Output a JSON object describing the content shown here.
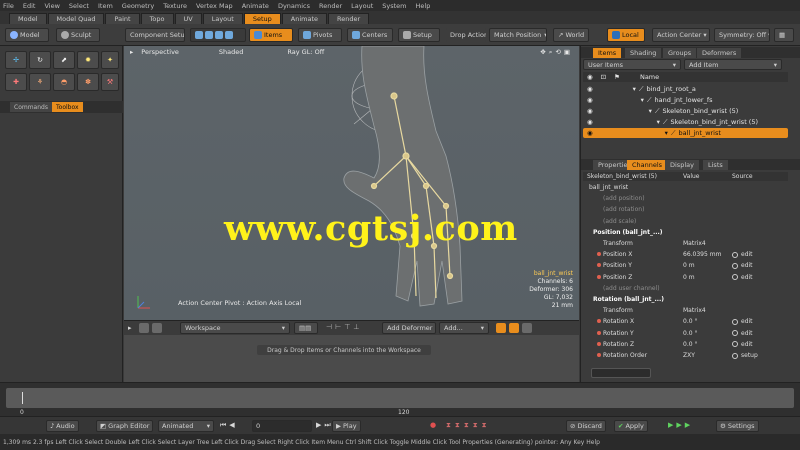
{
  "menu": [
    "File",
    "Edit",
    "View",
    "Select",
    "Item",
    "Geometry",
    "Texture",
    "Vertex Map",
    "Animate",
    "Dynamics",
    "Render",
    "Layout",
    "System",
    "Help"
  ],
  "layout_tabs": [
    "Model",
    "Model Quad",
    "Paint",
    "Topo",
    "UV",
    "Layout",
    "Setup",
    "Animate",
    "Render"
  ],
  "layout_active": "Setup",
  "toolbar": {
    "model_label": "Model",
    "sculpt_label": "Sculpt",
    "component_setup": "Component Setup",
    "items_label": "Items",
    "pivots_label": "Pivots",
    "centers_label": "Centers",
    "setup_label": "Setup",
    "drop_action": "Drop Action",
    "match_position": "Match Position",
    "world_label": "World",
    "local_label": "Local",
    "action_center": "Action Center",
    "symmetry": "Symmetry: Off"
  },
  "left_panel": {
    "tabs": [
      "Commands",
      "Toolbox"
    ],
    "active_tab": "Toolbox"
  },
  "viewport": {
    "view_label": "Perspective",
    "shading_label": "Shaded",
    "ray_gl": "Ray GL: Off",
    "watermark": "www.cgtsj.com",
    "info_lines": [
      "ball_jnt_wrist",
      "Channels: 6",
      "Deformer: 306",
      "GL: 7,032",
      "21 mm"
    ],
    "action_center_text": "Action Center Pivot : Action Axis Local"
  },
  "workspace": {
    "dropdown": "Workspace",
    "add_deformer": "Add Deformer",
    "add_label": "Add...",
    "hint": "Drag & Drop Items or Channels into the Workspace"
  },
  "items_panel": {
    "tabs": [
      "Items",
      "Shading",
      "Groups",
      "Deformers"
    ],
    "active_tab": "Items",
    "filter_label": "User Items",
    "add_item": "Add Item",
    "column_name": "Name",
    "rows": [
      {
        "label": "bind_jnt_root_a",
        "indent": 0
      },
      {
        "label": "hand_jnt_lower_fs",
        "indent": 1
      },
      {
        "label": "Skeleton_bind_wrist (5)",
        "indent": 2
      },
      {
        "label": "Skeleton_bind_jnt_wrist (5)",
        "indent": 3
      },
      {
        "label": "ball_jnt_wrist",
        "indent": 4
      }
    ]
  },
  "channels_panel": {
    "tabs": [
      "Properties",
      "Channels",
      "Display",
      "Lists"
    ],
    "active_tab": "Channels",
    "headers": [
      "Skeleton_bind_wrist (5)",
      "Value",
      "Source"
    ],
    "rows": [
      {
        "label": "ball_jnt_wrist",
        "value": "",
        "source": "",
        "kind": "group"
      },
      {
        "label": "(add position)",
        "value": "",
        "source": "",
        "kind": "muted"
      },
      {
        "label": "(add rotation)",
        "value": "",
        "source": "",
        "kind": "muted"
      },
      {
        "label": "(add scale)",
        "value": "",
        "source": "",
        "kind": "muted"
      },
      {
        "label": "Position (ball_jnt_...)",
        "value": "",
        "source": "",
        "kind": "section"
      },
      {
        "label": "Transform",
        "value": "Matrix4",
        "source": "",
        "kind": "plain"
      },
      {
        "label": "Position X",
        "value": "66.0395 mm",
        "source": "edit",
        "kind": "channel"
      },
      {
        "label": "Position Y",
        "value": "0 m",
        "source": "edit",
        "kind": "channel"
      },
      {
        "label": "Position Z",
        "value": "0 m",
        "source": "edit",
        "kind": "channel"
      },
      {
        "label": "(add user channel)",
        "value": "",
        "source": "",
        "kind": "muted"
      },
      {
        "label": "Rotation (ball_jnt_...)",
        "value": "",
        "source": "",
        "kind": "section"
      },
      {
        "label": "Transform",
        "value": "Matrix4",
        "source": "",
        "kind": "plain"
      },
      {
        "label": "Rotation X",
        "value": "0.0 °",
        "source": "edit",
        "kind": "channel"
      },
      {
        "label": "Rotation Y",
        "value": "0.0 °",
        "source": "edit",
        "kind": "channel"
      },
      {
        "label": "Rotation Z",
        "value": "0.0 °",
        "source": "edit",
        "kind": "channel"
      },
      {
        "label": "Rotation Order",
        "value": "ZXY",
        "source": "setup",
        "kind": "channel"
      }
    ],
    "search_placeholder": ""
  },
  "timeline": {
    "ticks": [
      "0",
      "120"
    ]
  },
  "transport": {
    "audio": "Audio",
    "graph_editor": "Graph Editor",
    "animated": "Animated",
    "frame": "0",
    "play": "Play",
    "discard": "Discard",
    "apply": "Apply",
    "settings": "Settings"
  },
  "status": "1,309 ms  2.3 fps   Left Click Select  Double Left Click Select Layer Tree  Left Click Drag Select  Right Click Item Menu  Ctrl Shift Click Toggle   Middle Click Tool  Properties (Generating) pointer: Any Key Help",
  "colors": {
    "accent": "#e88d1d",
    "watermark": "#fff21a"
  }
}
